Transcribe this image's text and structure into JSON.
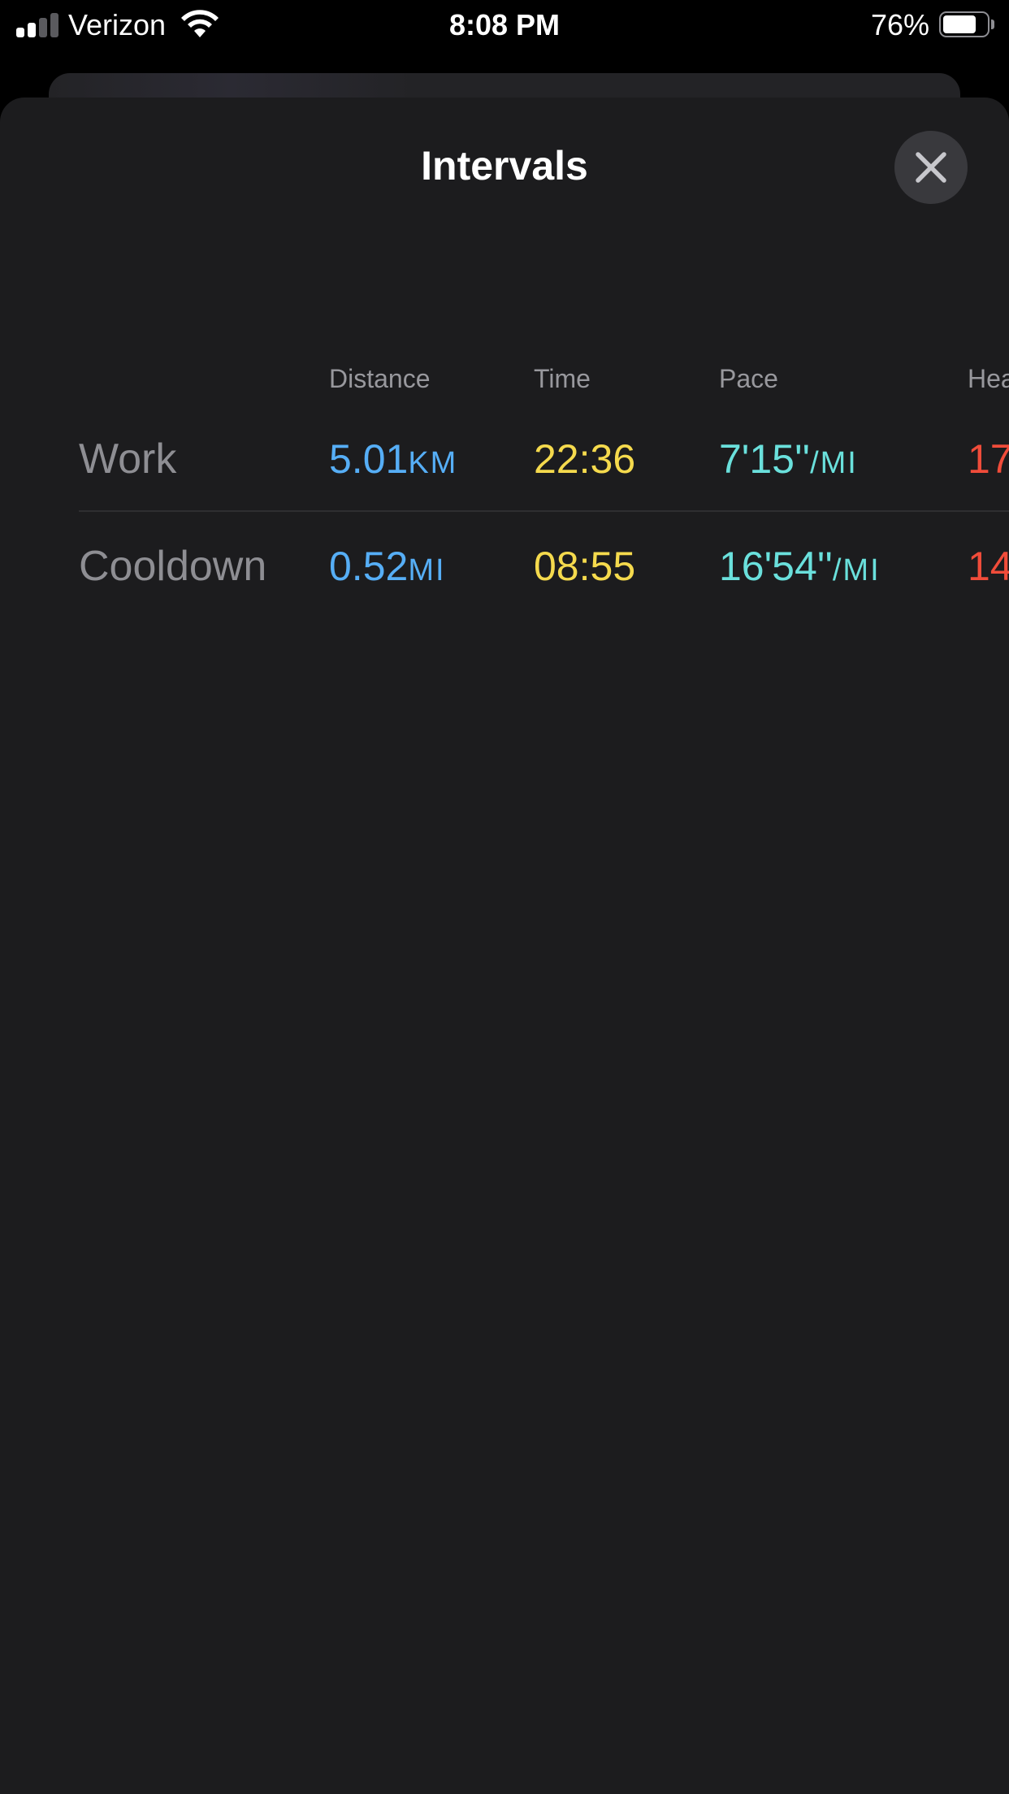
{
  "status_bar": {
    "carrier": "Verizon",
    "time": "8:08 PM",
    "battery_percent": "76%",
    "signal_bars": 2,
    "battery_level": 0.76
  },
  "sheet": {
    "title": "Intervals",
    "close_icon": "close-x-icon"
  },
  "table": {
    "headers": {
      "distance": "Distance",
      "time": "Time",
      "pace": "Pace",
      "heart_rate": "Hea"
    },
    "rows": [
      {
        "label": "Work",
        "distance_value": "5.01",
        "distance_unit": "KM",
        "time": "22:36",
        "pace_value": "7'15''",
        "pace_unit": "/MI",
        "heart_rate": "17"
      },
      {
        "label": "Cooldown",
        "distance_value": "0.52",
        "distance_unit": "MI",
        "time": "08:55",
        "pace_value": "16'54''",
        "pace_unit": "/MI",
        "heart_rate": "14"
      }
    ]
  },
  "colors": {
    "distance": "#56aef6",
    "time": "#f5da4d",
    "pace": "#6ae0dc",
    "heart_rate": "#f04c3a",
    "sheet_background": "#1c1c1e"
  }
}
